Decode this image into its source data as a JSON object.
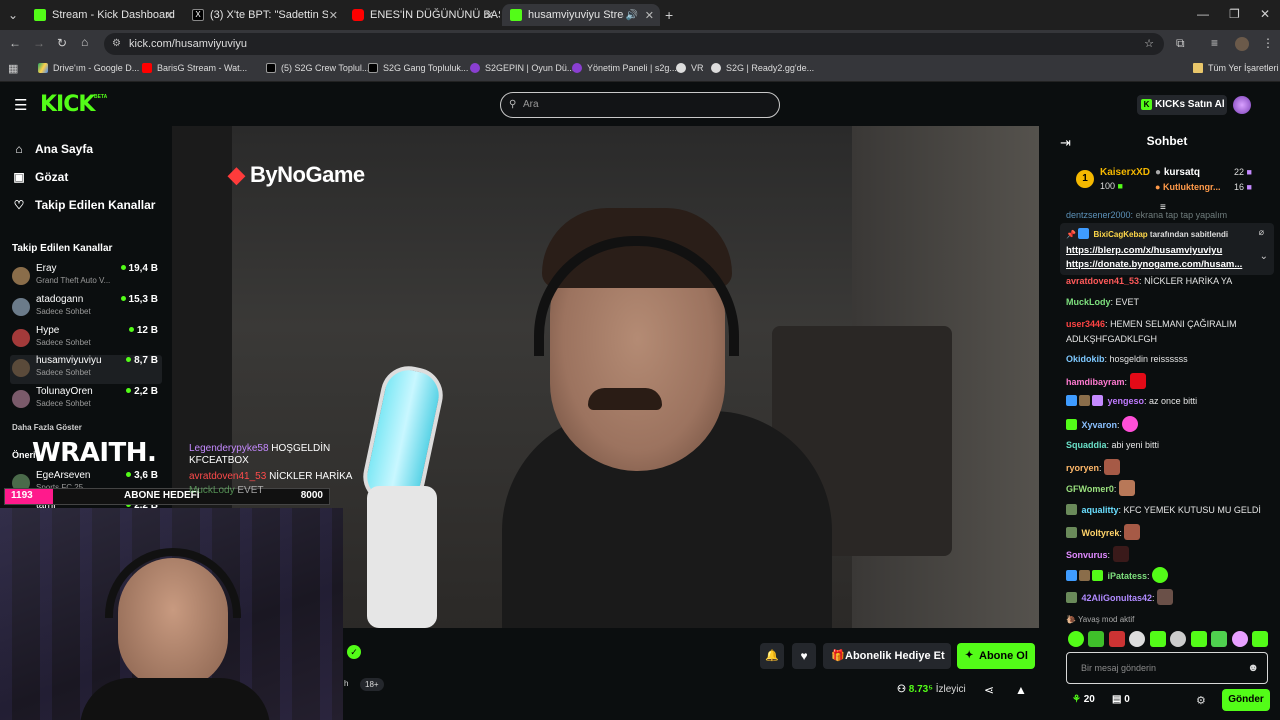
{
  "browser": {
    "tabs": [
      {
        "title": "Stream - Kick Dashboard",
        "color": "#53fc18"
      },
      {
        "title": "(3) X'te BPT: \"Sadettin Saran'a",
        "color": "#000000"
      },
      {
        "title": "ENES'İN DÜĞÜNÜNÜ BASTIK",
        "color": "#ff0000"
      },
      {
        "title": "husamviyuviyu Stream - W",
        "color": "#53fc18"
      }
    ],
    "url": "kick.com/husamviyuviyu",
    "bookmarks": [
      "Drive'ım - Google D...",
      "BarisG Stream - Wat...",
      "(5) S2G Crew Toplul...",
      "S2G Gang Topluluk...",
      "S2GEPIN | Oyun Dü...",
      "Yönetim Paneli | s2g...",
      "VR",
      "S2G | Ready2.gg'de..."
    ],
    "bookmarks_all": "Tüm Yer İşaretleri"
  },
  "header": {
    "logo": "KICK",
    "logo_beta": "BETA",
    "search_placeholder": "Ara",
    "buy_kicks": "KICKs Satın Al"
  },
  "sidebar": {
    "nav": [
      "Ana Sayfa",
      "Gözat",
      "Takip Edilen Kanallar"
    ],
    "followed_title": "Takip Edilen Kanallar",
    "channels": [
      {
        "name": "Eray",
        "sub": "Grand Theft Auto V...",
        "viewers": "19,4 B",
        "color": "#8a6d4a"
      },
      {
        "name": "atadogann",
        "sub": "Sadece Sohbet",
        "viewers": "15,3 B",
        "color": "#6b7b8a"
      },
      {
        "name": "Hype",
        "sub": "Sadece Sohbet",
        "viewers": "12 B",
        "color": "#a33a3a"
      },
      {
        "name": "husamviyuviyu",
        "sub": "Sadece Sohbet",
        "viewers": "8,7 B",
        "color": "#5a4a3a"
      },
      {
        "name": "TolunayOren",
        "sub": "Sadece Sohbet",
        "viewers": "2,2 B",
        "color": "#7a5a6a"
      }
    ],
    "show_more": "Daha Fazla Göster",
    "recommended_title": "Öneri",
    "recommended": [
      {
        "name": "EgeArseven",
        "sub": "Sports FC 25",
        "viewers": "3,6 B",
        "color": "#4a6a4a"
      },
      {
        "name": "tarhi",
        "sub": "",
        "viewers": "2,2 B",
        "color": "#6a4a4a"
      }
    ]
  },
  "overlay": {
    "brand": "ByNoGame",
    "wraith": "WRAITH.",
    "goal_current": "1193",
    "goal_label": "ABONE HEDEFİ",
    "goal_target": "8000",
    "goal_progress": 0.149,
    "chat_overlay": [
      {
        "user": "Legenderypyke58",
        "text": "HOŞGELDİN KFCEATBOX"
      },
      {
        "user": "avratdoven41_53",
        "text": "NİCKLER HARİKA"
      },
      {
        "user": "MuckLody",
        "text": "EVET"
      }
    ]
  },
  "player": {
    "age_badge": "18+",
    "gift_sub": "Abonelik Hediye Et",
    "subscribe": "Abone Ol",
    "viewers": "8.73⁵",
    "viewers_label": "İzleyici"
  },
  "chat": {
    "title": "Sohbet",
    "leaders": [
      {
        "rank": "1",
        "name": "KaiserxXD",
        "amount": "100"
      },
      {
        "name": "kursatq",
        "amount": "22"
      },
      {
        "name": "Kutluktengr...",
        "amount": "16"
      }
    ],
    "pinned_by": "BixiCagKebap",
    "pinned_suffix": "tarafından sabitlendi",
    "pinned_links": [
      "https://blerp.com/x/husamviyuviyu",
      "https://donate.bynogame.com/husam..."
    ],
    "top_cut": "ekrana tap tap yapalım",
    "messages": [
      {
        "user": "avratdoven41_53",
        "text": "NİCKLER HARİKA YA",
        "color": "#ff5a5a"
      },
      {
        "user": "MuckLody",
        "text": "EVET",
        "color": "#7ee07e"
      },
      {
        "user": "user3446",
        "text": "HEMEN SELMANI ÇAĞIRALIM ADLKŞHFGADKLFGH",
        "color": "#ff4444"
      },
      {
        "user": "Okidokib",
        "text": "hosgeldin reissssss",
        "color": "#7ec8ff"
      },
      {
        "user": "hamdibayram",
        "text": "",
        "color": "#ff7ad0"
      },
      {
        "user": "yengeso",
        "text": "az once bitti",
        "color": "#c07aff"
      },
      {
        "user": "Xyvaron",
        "text": "",
        "color": "#8ac0ff"
      },
      {
        "user": "Squaddia",
        "text": "abi yeni bitti",
        "color": "#6ae0c8"
      },
      {
        "user": "ryoryen",
        "text": "",
        "color": "#ffb86a"
      },
      {
        "user": "GFWomer0",
        "text": "",
        "color": "#9ae07e"
      },
      {
        "user": "aqualitty",
        "text": "KFC YEMEK KUTUSU MU GELDİ",
        "color": "#6adfff"
      },
      {
        "user": "Woltyrek",
        "text": "",
        "color": "#ffd36a"
      },
      {
        "user": "Sonvurus",
        "text": "",
        "color": "#e08aff"
      },
      {
        "user": "iPatatess",
        "text": "",
        "color": "#7ee07e"
      },
      {
        "user": "42AliGonultas42",
        "text": "",
        "color": "#b08aff"
      }
    ],
    "slow_mode": "Yavaş mod aktif",
    "input_placeholder": "Bir mesaj gönderin",
    "points": "20",
    "chest": "0",
    "send": "Gönder"
  },
  "colors": {
    "kick_green": "#53fc18",
    "bg": "#0b0e0f",
    "goal_pink": "#ff1a8c"
  }
}
